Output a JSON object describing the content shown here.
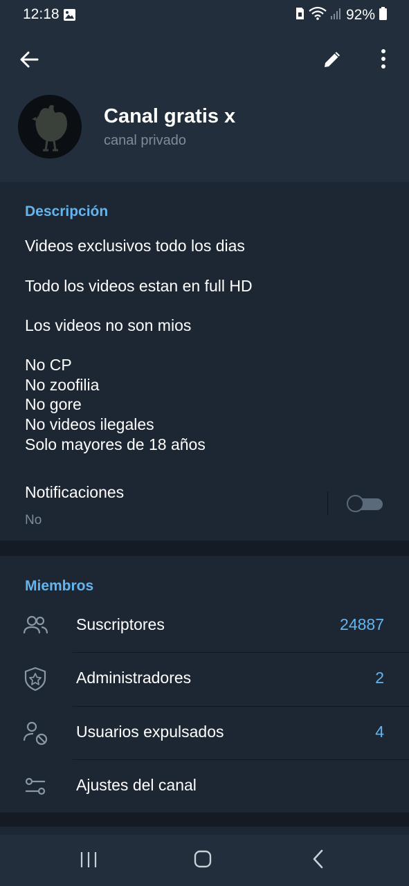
{
  "status_bar": {
    "time": "12:18",
    "battery": "92%",
    "icons": [
      "image-icon",
      "sim-icon",
      "wifi-icon",
      "signal-icon",
      "battery-icon"
    ]
  },
  "header": {
    "title": "Canal gratis x",
    "subtitle": "canal privado",
    "icons": [
      "back-arrow-icon",
      "pencil-icon",
      "more-vertical-icon"
    ]
  },
  "description": {
    "header": "Descripción",
    "lines": [
      "Videos exclusivos todo los dias",
      "Todo los videos estan en full HD",
      "Los videos no son mios",
      "No CP",
      "No zoofilia",
      "No gore",
      "No videos ilegales",
      "Solo mayores de 18 años"
    ]
  },
  "notifications": {
    "label": "Notificaciones",
    "value": "No",
    "enabled": false
  },
  "members": {
    "header": "Miembros",
    "rows": [
      {
        "label": "Suscriptores",
        "value": "24887",
        "icon": "people-icon"
      },
      {
        "label": "Administradores",
        "value": "2",
        "icon": "shield-star-icon"
      },
      {
        "label": "Usuarios expulsados",
        "value": "4",
        "icon": "user-block-icon"
      },
      {
        "label": "Ajustes del canal",
        "value": "",
        "icon": "sliders-icon"
      }
    ]
  },
  "colors": {
    "accent": "#64b5ef",
    "background": "#1d2733",
    "header_background": "#232e3c",
    "secondary_text": "#7e8b98"
  },
  "nav_bar": {
    "icons": [
      "recent-apps-icon",
      "home-icon",
      "back-nav-icon"
    ]
  }
}
